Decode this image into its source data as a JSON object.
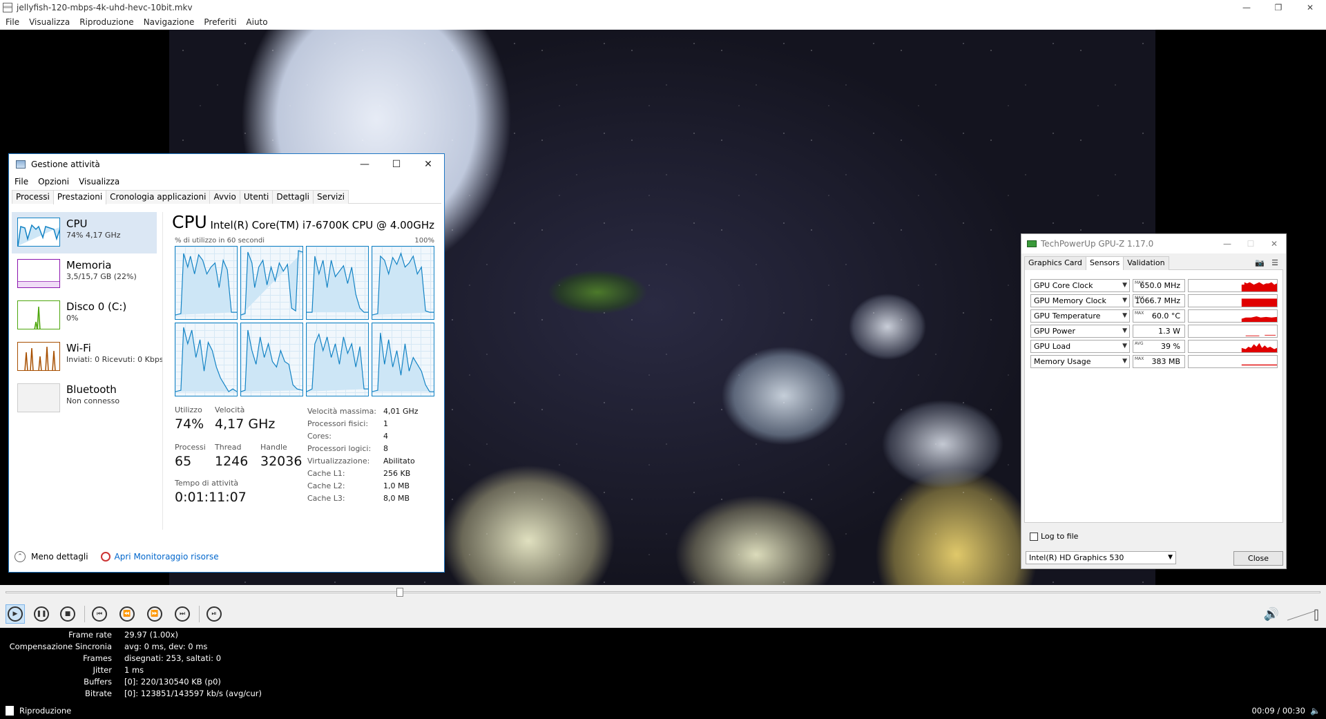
{
  "player": {
    "title": "jellyfish-120-mbps-4k-uhd-hevc-10bit.mkv",
    "menu": [
      "File",
      "Visualizza",
      "Riproduzione",
      "Navigazione",
      "Preferiti",
      "Aiuto"
    ],
    "seek_position": 0.3,
    "stats": [
      {
        "label": "Frame rate",
        "value": "29.97 (1.00x)"
      },
      {
        "label": "Compensazione Sincronia",
        "value": "avg: 0 ms, dev: 0 ms"
      },
      {
        "label": "Frames",
        "value": "disegnati: 253, saltati: 0"
      },
      {
        "label": "Jitter",
        "value": "1 ms"
      },
      {
        "label": "Buffers",
        "value": "[0]: 220/130540 KB (p0)"
      },
      {
        "label": "Bitrate",
        "value": "[0]: 123851/143597 kb/s (avg/cur)"
      }
    ],
    "status": "Riproduzione",
    "time": "00:09 / 00:30"
  },
  "taskmgr": {
    "title": "Gestione attività",
    "menu": [
      "File",
      "Opzioni",
      "Visualizza"
    ],
    "tabs": [
      "Processi",
      "Prestazioni",
      "Cronologia applicazioni",
      "Avvio",
      "Utenti",
      "Dettagli",
      "Servizi"
    ],
    "selected_tab": "Prestazioni",
    "resources": [
      {
        "name": "CPU",
        "sub": "74% 4,17 GHz",
        "color": "#1182c4"
      },
      {
        "name": "Memoria",
        "sub": "3,5/15,7 GB (22%)",
        "color": "#8b12ae"
      },
      {
        "name": "Disco 0 (C:)",
        "sub": "0%",
        "color": "#4da60c"
      },
      {
        "name": "Wi-Fi",
        "sub": "Inviati: 0 Ricevuti: 0 Kbps",
        "color": "#a74f01"
      },
      {
        "name": "Bluetooth",
        "sub": "Non connesso",
        "color": "#999999"
      }
    ],
    "cpu": {
      "title": "CPU",
      "model": "Intel(R) Core(TM) i7-6700K CPU @ 4.00GHz",
      "util_label": "% di utilizzo in 60 secondi",
      "util_max": "100%",
      "utilizzo_label": "Utilizzo",
      "utilizzo": "74%",
      "velocita_label": "Velocità",
      "velocita": "4,17 GHz",
      "processi_label": "Processi",
      "processi": "65",
      "thread_label": "Thread",
      "thread": "1246",
      "handle_label": "Handle",
      "handle": "32036",
      "uptime_label": "Tempo di attività",
      "uptime": "0:01:11:07",
      "details": [
        {
          "k": "Velocità massima:",
          "v": "4,01 GHz"
        },
        {
          "k": "Processori fisici:",
          "v": "1"
        },
        {
          "k": "Cores:",
          "v": "4"
        },
        {
          "k": "Processori logici:",
          "v": "8"
        },
        {
          "k": "Virtualizzazione:",
          "v": "Abilitato"
        },
        {
          "k": "Cache L1:",
          "v": "256 KB"
        },
        {
          "k": "Cache L2:",
          "v": "1,0 MB"
        },
        {
          "k": "Cache L3:",
          "v": "8,0 MB"
        }
      ]
    },
    "footer": {
      "less": "Meno dettagli",
      "monitor": "Apri Monitoraggio risorse"
    }
  },
  "gpuz": {
    "title": "TechPowerUp GPU-Z 1.17.0",
    "tabs": [
      "Graphics Card",
      "Sensors",
      "Validation"
    ],
    "selected_tab": "Sensors",
    "sensors": [
      {
        "name": "GPU Core Clock",
        "tag": "MAX",
        "value": "650.0 MHz"
      },
      {
        "name": "GPU Memory Clock",
        "tag": "MAX",
        "value": "1066.7 MHz"
      },
      {
        "name": "GPU Temperature",
        "tag": "MAX",
        "value": "60.0 °C"
      },
      {
        "name": "GPU Power",
        "tag": "",
        "value": "1.3 W"
      },
      {
        "name": "GPU Load",
        "tag": "AVG",
        "value": "39 %"
      },
      {
        "name": "Memory Usage",
        "tag": "MAX",
        "value": "383 MB"
      }
    ],
    "log_label": "Log to file",
    "gpu": "Intel(R) HD Graphics 530",
    "close": "Close"
  }
}
